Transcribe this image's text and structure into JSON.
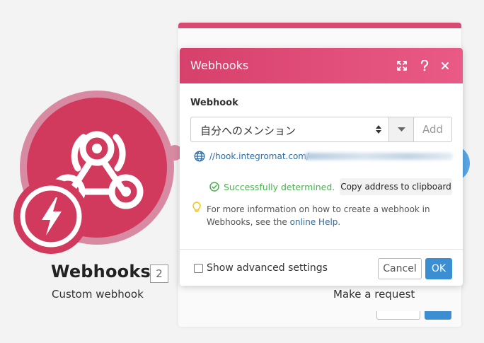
{
  "colors": {
    "brand_pink": "#d1395d",
    "header_gradient_start": "#d6416b",
    "header_gradient_end": "#ea5a86",
    "ok_blue": "#3b8ed1",
    "success_green": "#4caf50",
    "link_blue": "#2b6ca8"
  },
  "module": {
    "title": "Webhooks",
    "count": "2",
    "subtitle": "Custom webhook",
    "icon": "webhook-icon",
    "badge_icon": "lightning-bolt-icon"
  },
  "next_module": {
    "subtitle": "Make a request"
  },
  "dialog": {
    "title": "Webhooks",
    "header_icons": [
      "expand-icon",
      "help-icon",
      "close-icon"
    ],
    "field_label": "Webhook",
    "selected_webhook": "自分へのメンション",
    "add_label": "Add",
    "url_prefix": "//hook.integromat.com/",
    "status_text": "Successfully determined.",
    "copy_label": "Copy address to clipboard",
    "info_text_prefix": "For more information on how to create a webhook in Webhooks, see the ",
    "info_link": "online Help",
    "info_text_suffix": ".",
    "advanced_label": "Show advanced settings",
    "cancel_label": "Cancel",
    "ok_label": "OK"
  }
}
